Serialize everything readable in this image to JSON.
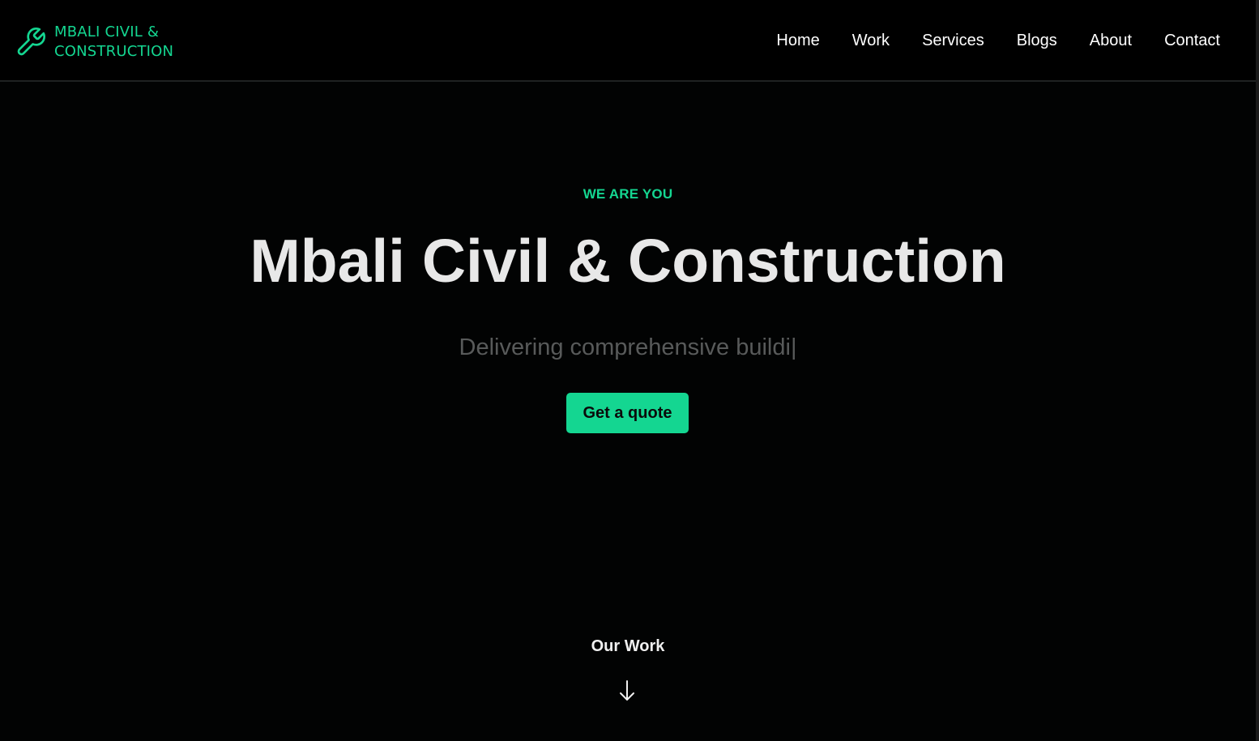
{
  "brand": {
    "name": "MBALI CIVIL &\nCONSTRUCTION",
    "icon": "wrench-icon",
    "color": "#14d691"
  },
  "nav": {
    "items": [
      {
        "label": "Home"
      },
      {
        "label": "Work"
      },
      {
        "label": "Services"
      },
      {
        "label": "Blogs"
      },
      {
        "label": "About"
      },
      {
        "label": "Contact"
      }
    ]
  },
  "hero": {
    "eyebrow": "WE ARE YOU",
    "title": "Mbali Civil & Construction",
    "subtitle": "Delivering comprehensive buildi|",
    "cta_label": "Get a quote"
  },
  "scroll_hint": {
    "label": "Our Work",
    "icon": "arrow-down-icon"
  },
  "colors": {
    "accent": "#14d691",
    "background": "#020303",
    "text": "#e8e8e8"
  }
}
